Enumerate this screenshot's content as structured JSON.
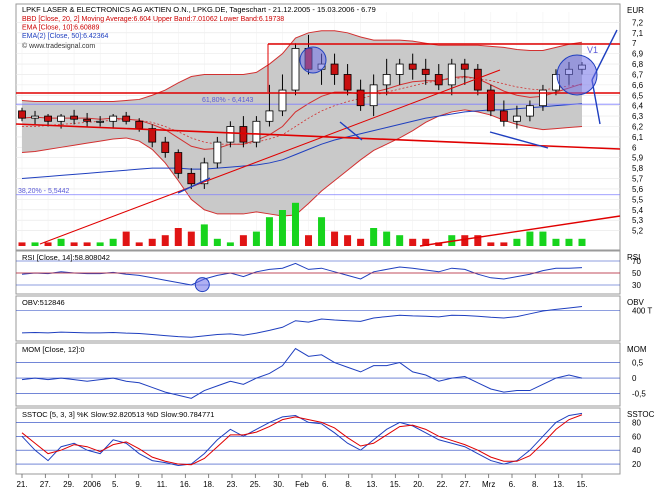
{
  "chart_data": [
    {
      "type": "candlestick",
      "title": "LPKF LASER & ELECTRONICS AG AKTIEN O.N., LPKG.DE, Tageschart - 21.12.2005 - 15.03.2006 - 6.79",
      "currency": "EUR",
      "watermark": "© www.tradesignal.com",
      "ylim": [
        5.1,
        7.3
      ],
      "y_ticks": [
        "7,2",
        "7,1",
        "7",
        "6,9",
        "6,8",
        "6,7",
        "6,6",
        "6,5",
        "6,4",
        "6,3",
        "6,2",
        "6,1",
        "6",
        "5,9",
        "5,8",
        "5,7",
        "5,6",
        "5,5",
        "5,4",
        "5,3",
        "5,2"
      ],
      "x_ticks": [
        "21.",
        "27.",
        "29.",
        "2006",
        "5.",
        "9.",
        "11.",
        "16.",
        "18.",
        "23.",
        "25.",
        "30.",
        "Feb",
        "6.",
        "8.",
        "13.",
        "15.",
        "20.",
        "22.",
        "27.",
        "Mrz",
        "6.",
        "8.",
        "13.",
        "15."
      ],
      "legend": [
        {
          "label": "BBD [Close, 20, 2] Moving Average:6.604 Upper Band:7.01062 Lower Band:6.19738",
          "color": "#cc0000"
        },
        {
          "label": "EMA [Close, 10]:6.60889",
          "color": "#cc0000"
        },
        {
          "label": "EMA(2) [Close, 50]:6.42364",
          "color": "#1f3fbf"
        }
      ],
      "annotations": [
        "61,80% - 6,4143",
        "38,20% - 5,5442",
        "V1"
      ],
      "series": [
        {
          "name": "Open",
          "values": [
            6.35,
            6.28,
            6.3,
            6.25,
            6.3,
            6.27,
            6.25,
            6.25,
            6.3,
            6.25,
            6.18,
            6.05,
            5.95,
            5.75,
            5.65,
            5.85,
            6.05,
            6.2,
            6.05,
            6.25,
            6.35,
            6.55,
            6.95,
            6.75,
            6.8,
            6.7,
            6.55,
            6.4,
            6.6,
            6.7,
            6.8,
            6.75,
            6.7,
            6.6,
            6.8,
            6.75,
            6.55,
            6.35,
            6.25,
            6.3,
            6.4,
            6.55,
            6.7,
            6.75
          ]
        },
        {
          "name": "High",
          "values": [
            6.38,
            6.35,
            6.32,
            6.32,
            6.36,
            6.33,
            6.3,
            6.32,
            6.34,
            6.28,
            6.22,
            6.1,
            5.98,
            5.8,
            5.9,
            6.1,
            6.25,
            6.3,
            6.3,
            6.6,
            6.7,
            7.0,
            7.08,
            6.9,
            6.9,
            6.8,
            6.65,
            6.7,
            6.85,
            6.85,
            6.9,
            6.85,
            6.8,
            6.85,
            6.85,
            6.8,
            6.6,
            6.45,
            6.4,
            6.45,
            6.6,
            6.75,
            6.82,
            6.82
          ]
        },
        {
          "name": "Low",
          "values": [
            6.25,
            6.22,
            6.2,
            6.18,
            6.22,
            6.2,
            6.2,
            6.18,
            6.22,
            6.15,
            6.0,
            5.9,
            5.7,
            5.6,
            5.6,
            5.8,
            6.0,
            6.0,
            6.0,
            6.2,
            6.3,
            6.5,
            6.7,
            6.6,
            6.6,
            6.5,
            6.35,
            6.3,
            6.5,
            6.6,
            6.65,
            6.6,
            6.55,
            6.5,
            6.6,
            6.5,
            6.3,
            6.2,
            6.18,
            6.25,
            6.35,
            6.5,
            6.6,
            6.7
          ]
        },
        {
          "name": "Close",
          "values": [
            6.28,
            6.3,
            6.25,
            6.3,
            6.27,
            6.25,
            6.25,
            6.3,
            6.25,
            6.18,
            6.05,
            5.95,
            5.75,
            5.65,
            5.85,
            6.05,
            6.2,
            6.05,
            6.25,
            6.35,
            6.55,
            6.95,
            6.75,
            6.8,
            6.7,
            6.55,
            6.4,
            6.6,
            6.7,
            6.8,
            6.75,
            6.7,
            6.6,
            6.8,
            6.75,
            6.55,
            6.35,
            6.25,
            6.3,
            6.4,
            6.55,
            6.7,
            6.75,
            6.79
          ]
        },
        {
          "name": "EMA [Close, 10]",
          "values": [
            6.28,
            6.29,
            6.28,
            6.28,
            6.28,
            6.28,
            6.27,
            6.28,
            6.27,
            6.26,
            6.22,
            6.17,
            6.09,
            6.01,
            5.98,
            5.99,
            6.03,
            6.03,
            6.07,
            6.12,
            6.2,
            6.34,
            6.42,
            6.49,
            6.53,
            6.53,
            6.51,
            6.53,
            6.56,
            6.6,
            6.63,
            6.64,
            6.64,
            6.67,
            6.68,
            6.66,
            6.6,
            6.54,
            6.5,
            6.48,
            6.49,
            6.53,
            6.57,
            6.61
          ]
        },
        {
          "name": "EMA(2) [Close, 50]",
          "values": [
            5.7,
            5.71,
            5.72,
            5.73,
            5.74,
            5.75,
            5.76,
            5.77,
            5.78,
            5.79,
            5.8,
            5.8,
            5.8,
            5.79,
            5.79,
            5.8,
            5.81,
            5.82,
            5.83,
            5.85,
            5.88,
            5.93,
            5.98,
            6.03,
            6.07,
            6.1,
            6.13,
            6.16,
            6.19,
            6.22,
            6.25,
            6.28,
            6.3,
            6.32,
            6.34,
            6.35,
            6.36,
            6.36,
            6.37,
            6.38,
            6.39,
            6.4,
            6.41,
            6.42
          ]
        },
        {
          "name": "Moving Average",
          "values": [
            6.2,
            6.2,
            6.21,
            6.22,
            6.23,
            6.24,
            6.25,
            6.26,
            6.27,
            6.26,
            6.24,
            6.2,
            6.15,
            6.09,
            6.05,
            6.03,
            6.03,
            6.03,
            6.05,
            6.08,
            6.12,
            6.2,
            6.28,
            6.35,
            6.4,
            6.44,
            6.47,
            6.5,
            6.53,
            6.56,
            6.59,
            6.62,
            6.64,
            6.66,
            6.67,
            6.66,
            6.64,
            6.61,
            6.58,
            6.56,
            6.55,
            6.57,
            6.59,
            6.6
          ]
        },
        {
          "name": "Upper Band",
          "values": [
            6.45,
            6.44,
            6.44,
            6.44,
            6.44,
            6.44,
            6.44,
            6.44,
            6.45,
            6.46,
            6.5,
            6.55,
            6.62,
            6.68,
            6.7,
            6.7,
            6.7,
            6.7,
            6.72,
            6.8,
            6.9,
            7.05,
            7.1,
            7.12,
            7.12,
            7.1,
            7.06,
            7.03,
            7.03,
            7.03,
            7.02,
            7.0,
            6.98,
            6.98,
            6.98,
            6.98,
            6.97,
            6.96,
            6.94,
            6.93,
            6.93,
            6.96,
            6.99,
            7.01
          ]
        },
        {
          "name": "Lower Band",
          "values": [
            5.95,
            5.96,
            5.98,
            6.0,
            6.02,
            6.04,
            6.06,
            6.08,
            6.09,
            6.06,
            5.98,
            5.85,
            5.68,
            5.5,
            5.4,
            5.36,
            5.36,
            5.36,
            5.38,
            5.36,
            5.34,
            5.35,
            5.46,
            5.58,
            5.68,
            5.78,
            5.88,
            5.97,
            6.03,
            6.09,
            6.16,
            6.24,
            6.3,
            6.34,
            6.36,
            6.34,
            6.31,
            6.26,
            6.22,
            6.19,
            6.17,
            6.18,
            6.19,
            6.2
          ]
        },
        {
          "name": "Volume",
          "values": [
            1,
            1,
            1,
            2,
            1,
            1,
            1,
            2,
            4,
            1,
            2,
            3,
            5,
            4,
            6,
            2,
            1,
            3,
            4,
            8,
            10,
            12,
            3,
            8,
            4,
            3,
            2,
            5,
            4,
            3,
            2,
            2,
            1,
            3,
            3,
            3,
            1,
            1,
            2,
            4,
            4,
            2,
            2,
            2
          ]
        }
      ]
    },
    {
      "type": "line",
      "title": "RSI [Close, 14]:58.808042",
      "y_ticks": [
        "70",
        "50",
        "30"
      ],
      "ylim": [
        20,
        80
      ],
      "series": [
        {
          "name": "RSI [Close, 14]",
          "values": [
            48,
            50,
            49,
            52,
            50,
            49,
            49,
            51,
            48,
            46,
            42,
            38,
            34,
            30,
            40,
            46,
            50,
            44,
            52,
            56,
            58,
            66,
            56,
            58,
            52,
            46,
            40,
            52,
            56,
            60,
            58,
            55,
            52,
            58,
            56,
            48,
            42,
            40,
            44,
            48,
            54,
            58,
            58,
            59
          ]
        }
      ]
    },
    {
      "type": "line",
      "title": "OBV:512846",
      "y_ticks": [
        "400 T"
      ],
      "ylim": [
        -400,
        700
      ],
      "series": [
        {
          "name": "OBV",
          "values": [
            -250,
            -240,
            -250,
            -230,
            -240,
            -250,
            -250,
            -240,
            -260,
            -270,
            -300,
            -330,
            -360,
            -380,
            -340,
            -300,
            -280,
            -320,
            -260,
            -180,
            -90,
            100,
            60,
            150,
            120,
            100,
            80,
            180,
            220,
            260,
            240,
            230,
            210,
            260,
            250,
            230,
            200,
            180,
            220,
            300,
            380,
            430,
            470,
            513
          ]
        }
      ]
    },
    {
      "type": "line",
      "title": "MOM [Close, 12]:0",
      "y_ticks": [
        "0,5",
        "0",
        "-0,5"
      ],
      "ylim": [
        -0.8,
        1.0
      ],
      "series": [
        {
          "name": "MOM [Close, 12]",
          "values": [
            -0.05,
            0.0,
            -0.05,
            0.0,
            -0.05,
            -0.1,
            -0.05,
            0.0,
            -0.1,
            -0.15,
            -0.3,
            -0.45,
            -0.55,
            -0.65,
            -0.4,
            -0.25,
            -0.1,
            -0.2,
            0.0,
            0.15,
            0.4,
            0.95,
            0.7,
            0.75,
            0.5,
            0.35,
            0.2,
            0.4,
            0.4,
            0.5,
            0.2,
            0.1,
            -0.1,
            0.0,
            0.05,
            -0.15,
            -0.35,
            -0.45,
            -0.4,
            -0.4,
            -0.2,
            0.0,
            0.1,
            0.0
          ]
        }
      ]
    },
    {
      "type": "line",
      "title": "SSTOC [5, 3, 3] %K Slow:92.820513 %D Slow:90.784771",
      "y_ticks": [
        "80",
        "60",
        "40",
        "20"
      ],
      "ylim": [
        10,
        95
      ],
      "series": [
        {
          "name": "%K Slow",
          "values": [
            60,
            40,
            25,
            45,
            50,
            40,
            35,
            55,
            50,
            35,
            25,
            22,
            18,
            20,
            35,
            55,
            70,
            60,
            70,
            80,
            88,
            90,
            80,
            78,
            65,
            50,
            40,
            55,
            70,
            80,
            75,
            65,
            55,
            50,
            45,
            35,
            25,
            20,
            25,
            40,
            60,
            80,
            90,
            93
          ]
        },
        {
          "name": "%D Slow",
          "values": [
            65,
            50,
            35,
            40,
            48,
            45,
            38,
            48,
            52,
            42,
            30,
            24,
            20,
            19,
            28,
            45,
            62,
            62,
            66,
            74,
            84,
            88,
            84,
            80,
            72,
            58,
            46,
            50,
            62,
            74,
            76,
            70,
            60,
            54,
            48,
            40,
            30,
            24,
            24,
            32,
            50,
            70,
            84,
            91
          ]
        }
      ]
    }
  ]
}
